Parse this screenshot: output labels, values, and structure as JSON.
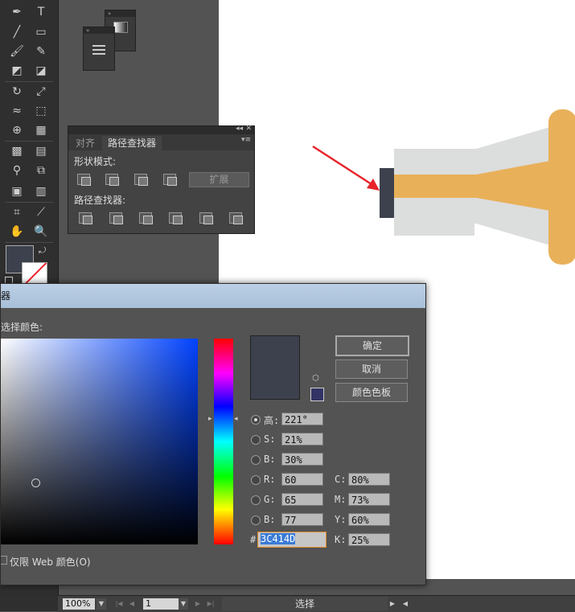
{
  "pathfinder_panel": {
    "tabs": [
      "对齐",
      "路径查找器"
    ],
    "active_tab": 1,
    "shape_modes_label": "形状模式:",
    "expand_label": "扩展",
    "pathfinders_label": "路径查找器:"
  },
  "color_picker": {
    "title": "器",
    "select_color_label": "选择颜色:",
    "ok_label": "确定",
    "cancel_label": "取消",
    "swatches_label": "颜色色板",
    "web_only_label": "仅限 Web 颜色(O)",
    "fields": {
      "H": {
        "label": "高:",
        "value": "221°",
        "checked": true
      },
      "S": {
        "label": "S:",
        "value": "21%"
      },
      "Bright": {
        "label": "B:",
        "value": "30%"
      },
      "R": {
        "label": "R:",
        "value": "60"
      },
      "G": {
        "label": "G:",
        "value": "65"
      },
      "Blue": {
        "label": "B:",
        "value": "77"
      },
      "C": {
        "label": "C:",
        "value": "80%"
      },
      "M": {
        "label": "M:",
        "value": "73%"
      },
      "Y": {
        "label": "Y:",
        "value": "60%"
      },
      "K": {
        "label": "K:",
        "value": "25%"
      }
    },
    "hex_label": "#",
    "hex_value": "3C414D",
    "current_color": "#3c414d",
    "web_safe_color": "#333366"
  },
  "status_bar": {
    "zoom": "100%",
    "artboard": "1",
    "mode": "选择"
  },
  "artwork": {
    "cap_color": "#3c414d",
    "light_grey": "#dcdddd",
    "orange": "#e9b05a",
    "arrow_color": "#e8242b"
  }
}
